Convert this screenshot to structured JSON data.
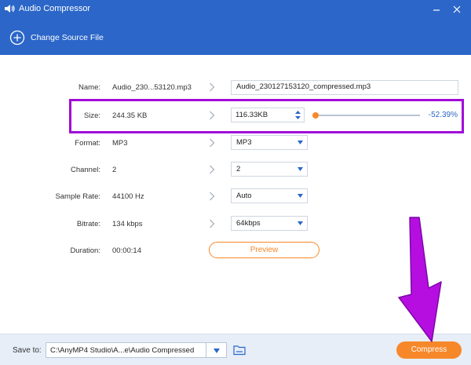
{
  "window": {
    "title": "Audio Compressor"
  },
  "toolbar": {
    "change_source_label": "Change Source File"
  },
  "fields": {
    "name": {
      "label": "Name:",
      "original": "Audio_230...53120.mp3",
      "output": "Audio_230127153120_compressed.mp3"
    },
    "size": {
      "label": "Size:",
      "original": "244.35 KB",
      "output": "116.33KB",
      "slider_fraction": 0.0,
      "percent": "-52.39%"
    },
    "format": {
      "label": "Format:",
      "original": "MP3",
      "selected": "MP3"
    },
    "channel": {
      "label": "Channel:",
      "original": "2",
      "selected": "2"
    },
    "sample_rate": {
      "label": "Sample Rate:",
      "original": "44100 Hz",
      "selected": "Auto"
    },
    "bitrate": {
      "label": "Bitrate:",
      "original": "134 kbps",
      "selected": "64kbps"
    },
    "duration": {
      "label": "Duration:",
      "original": "00:00:14"
    }
  },
  "preview_label": "Preview",
  "bottom": {
    "save_label": "Save to:",
    "save_path": "C:\\AnyMP4 Studio\\A...e\\Audio Compressed",
    "compress_label": "Compress"
  },
  "colors": {
    "title_bar": "#2b66c8",
    "accent": "#f7882a",
    "highlight": "#a10ad8",
    "percent_text": "#2b66c8",
    "bottom_bar": "#e7eef8"
  },
  "icons": {
    "app": "speaker-icon",
    "minimize": "minimize-icon",
    "close": "close-icon",
    "add": "plus-circle-icon",
    "arrow": "chevron-right-icon",
    "folder": "folder-icon"
  }
}
